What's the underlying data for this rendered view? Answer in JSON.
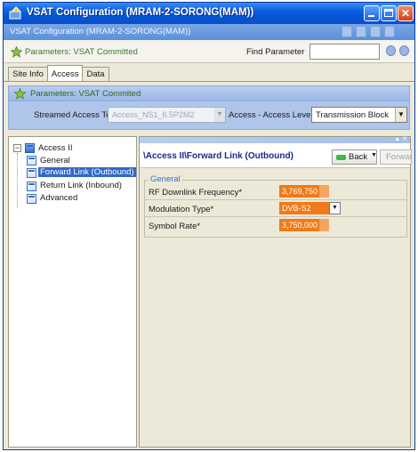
{
  "window": {
    "title": "VSAT Configuration (MRAM-2-SORONG(MAM))",
    "subtitle": "VSAT Configuration (MRAM-2-SORONG(MAM))"
  },
  "toolbar": {
    "status_text": "Parameters: VSAT Committed",
    "find_label": "Find Parameter",
    "find_value": ""
  },
  "tabs": [
    {
      "label": "Site Info",
      "active": false
    },
    {
      "label": "Access",
      "active": true
    },
    {
      "label": "Data",
      "active": false
    }
  ],
  "inner": {
    "status_text": "Parameters: VSAT Commited",
    "streamed_label": "Streamed Access Template",
    "streamed_value": "Access_NS1_6.5P2M2",
    "level_label": "Access - Access Level",
    "level_value": "Transmission Block"
  },
  "tree": {
    "root": "Access II",
    "items": [
      {
        "label": "General",
        "selected": false
      },
      {
        "label": "Forward Link (Outbound)",
        "selected": true
      },
      {
        "label": "Return Link (Inbound)",
        "selected": false
      },
      {
        "label": "Advanced",
        "selected": false
      }
    ]
  },
  "content": {
    "path": "\\Access II\\Forward Link (Outbound)",
    "back_label": "Back",
    "forward_label": "Forward",
    "group_label": "General",
    "params": [
      {
        "label": "RF Downlink Frequency*",
        "value": "3,769,750"
      },
      {
        "label": "Modulation Type*",
        "value": "DVB-S2"
      },
      {
        "label": "Symbol Rate*",
        "value": "3,750,000"
      }
    ]
  },
  "colors": {
    "title_bar": "#0456d8",
    "accent": "#3169c6",
    "value_fill": "#f07a18",
    "committed_text": "#3a7a2a"
  }
}
